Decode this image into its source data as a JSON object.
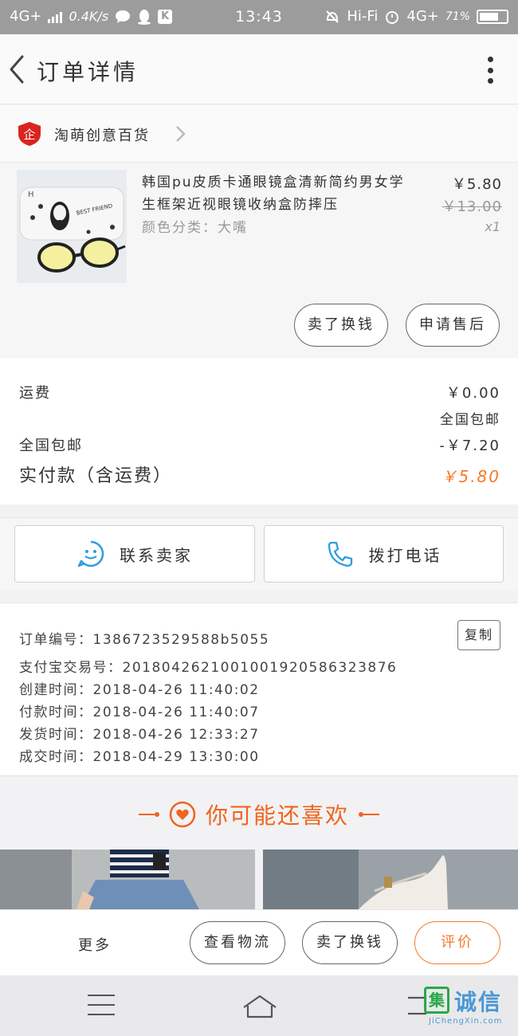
{
  "status_bar": {
    "network": "4G+",
    "speed": "0.4K/s",
    "time": "13:43",
    "wifi": "Hi-Fi",
    "network2": "4G+",
    "battery": "71%",
    "battery_level": 0.71,
    "app_badge": "K",
    "icons": [
      "signal-icon",
      "chat-icon",
      "qq-icon",
      "k-app-icon",
      "mute-icon",
      "alarm-icon"
    ]
  },
  "header": {
    "title": "订单详情",
    "back_icon": "chevron-left-icon",
    "more_icon": "more-vertical-icon"
  },
  "shop": {
    "name": "淘萌创意百货",
    "badge_text": "企",
    "badge_color": "#d9251d"
  },
  "product": {
    "name": "韩国pu皮质卡通眼镜盒清新简约男女学生框架近视眼镜收纳盒防摔压",
    "spec": "颜色分类：大嘴",
    "price": "￥5.80",
    "original_price": "￥13.00",
    "quantity": "x1",
    "image_text": "BEST FRIEND",
    "image_letter": "H",
    "buttons": {
      "sell_exchange": "卖了换钱",
      "after_sale": "申请售后"
    }
  },
  "fees": {
    "shipping_label": "运费",
    "shipping_value": "￥0.00",
    "shipping_note": "全国包邮",
    "discount_label": "全国包邮",
    "discount_value": "-￥7.20",
    "total_label": "实付款（含运费）",
    "total_value": "￥5.80",
    "accent_color": "#f47a2a"
  },
  "contact": {
    "seller": "联系卖家",
    "phone": "拨打电话",
    "icon_color": "#2d9ce0"
  },
  "order_info": {
    "rows": [
      "订单编号：1386723529588b5055",
      "支付宝交易号：2018042621001001920586323876",
      "创建时间：2018-04-26 11:40:02",
      "付款时间：2018-04-26 11:40:07",
      "发货时间：2018-04-26 12:33:27",
      "成交时间：2018-04-29 13:30:00"
    ],
    "copy_label": "复制"
  },
  "recommend": {
    "title": "你可能还喜欢",
    "color": "#f0641e"
  },
  "action_bar": {
    "more": "更多",
    "logistics": "查看物流",
    "sell": "卖了换钱",
    "review": "评价"
  },
  "system_nav": {
    "icons": [
      "menu-icon",
      "home-icon",
      "back-icon"
    ]
  },
  "watermark": {
    "box_char": "集",
    "text": "诚信",
    "url": "JiChengXin.com"
  }
}
